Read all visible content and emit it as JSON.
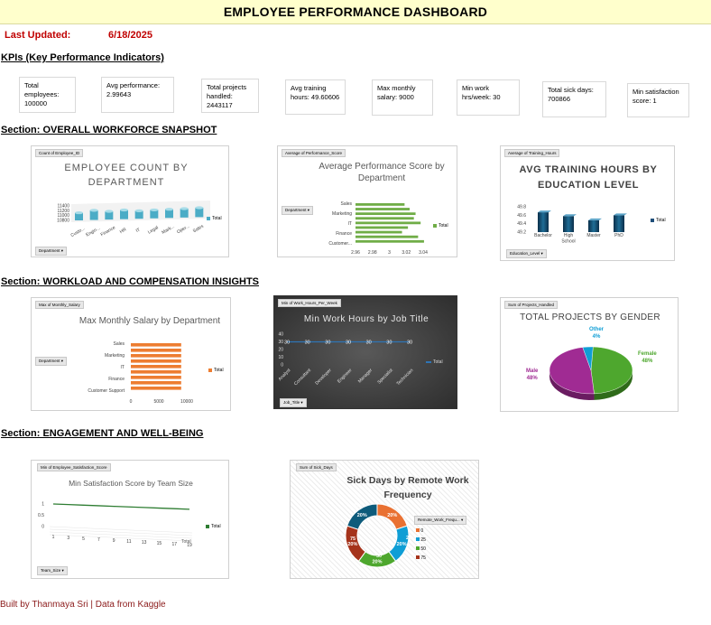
{
  "title": "EMPLOYEE PERFORMANCE DASHBOARD",
  "last_updated_label": "Last Updated:",
  "last_updated_value": "6/18/2025",
  "kpi_header": "KPIs (Key Performance Indicators)",
  "kpis": [
    {
      "text": "Total employees: 100000",
      "color": "#9dc3e6"
    },
    {
      "text": "Avg performance: 2.99643",
      "color": "#ed7d31"
    },
    {
      "text": "Total projects handled: 2443117",
      "color": "#92e28e"
    },
    {
      "text": "Avg training hours: 49.60606",
      "color": "#cccc00"
    },
    {
      "text": "Max monthly salary: 9000",
      "color": "#bfbfbf"
    },
    {
      "text": "Min work hrs/week: 30",
      "color": "#c48ef0"
    },
    {
      "text": "Total sick days: 700866",
      "color": "#f8cbcb"
    },
    {
      "text": "Min satisfaction score: 1",
      "color": "#ecc47e"
    }
  ],
  "sections": {
    "s1": "Section: OVERALL WORKFORCE SNAPSHOT",
    "s2": "Section: WORKLOAD AND COMPENSATION INSIGHTS",
    "s3": "Section: ENGAGEMENT AND WELL-BEING"
  },
  "charts": {
    "emp": {
      "field": "Count of Employee_ID",
      "title_l1": "EMPLOYEE COUNT BY",
      "title_l2": "DEPARTMENT",
      "filter": "Department",
      "legend": "Total",
      "ticks": [
        "11400",
        "11200",
        "11000",
        "10800"
      ],
      "categories": [
        "Custo...",
        "Engin...",
        "Finance",
        "HR",
        "IT",
        "Legal",
        "Mark...",
        "Oper...",
        "Sales"
      ],
      "values": [
        11116,
        11200,
        11140,
        11180,
        11131,
        11150,
        11160,
        11170,
        11190
      ],
      "ylim": [
        10800,
        11400
      ]
    },
    "perf": {
      "field": "Average of Performance_Score",
      "title_l1": "Average Performance Score by",
      "title_l2": "Department",
      "filter": "Department",
      "legend": "Total",
      "categories": [
        "Sales",
        "Marketing",
        "IT",
        "Finance",
        "Customer..."
      ],
      "values": [
        3.018,
        3.024,
        3.031,
        3.029,
        3.037,
        3.022,
        3.015,
        3.034,
        3.041
      ],
      "xticks": [
        "2.96",
        "2.98",
        "3",
        "3.02",
        "3.04"
      ],
      "xlim": [
        2.96,
        3.04
      ]
    },
    "train": {
      "field": "Average of Training_Hours",
      "title_l1": "AVG TRAINING HOURS BY",
      "title_l2": "EDUCATION LEVEL",
      "filter": "Education_Level",
      "legend": "Total",
      "ticks": [
        "49.8",
        "49.6",
        "49.4",
        "49.2"
      ],
      "categories": [
        "Bachelor",
        "High School",
        "Master",
        "PhD"
      ],
      "values": [
        49.67,
        49.58,
        49.48,
        49.6
      ],
      "ylim": [
        49.2,
        49.8
      ]
    },
    "salary": {
      "field": "Max of Monthly_Salary",
      "title": "Max Monthly Salary by Department",
      "filter": "Department",
      "legend": "Total",
      "categories": [
        "Sales",
        "Marketing",
        "IT",
        "Finance",
        "Customer Support"
      ],
      "values": [
        9000,
        9000,
        9000,
        9000,
        9000,
        9000,
        9000,
        9000,
        9000
      ],
      "xticks": [
        "0",
        "5000",
        "10000"
      ],
      "xlim": [
        0,
        10000
      ]
    },
    "hours": {
      "field": "Min of Work_Hours_Per_Week",
      "title": "Min Work Hours by Job Title",
      "filter": "Job_Title",
      "legend": "Total",
      "ticks": [
        "40",
        "30",
        "20",
        "10",
        "0"
      ],
      "categories": [
        "Analyst",
        "Consultant",
        "Developer",
        "Engineer",
        "Manager",
        "Specialist",
        "Technician"
      ],
      "values": [
        30,
        30,
        30,
        30,
        30,
        30,
        30
      ],
      "data_labels": [
        "30",
        "30",
        "30",
        "30",
        "30",
        "30",
        "30"
      ],
      "ylim": [
        0,
        40
      ]
    },
    "gender": {
      "field": "Sum of Projects_Handled",
      "title": "TOTAL PROJECTS BY GENDER",
      "slices": [
        {
          "name": "Female",
          "value": 48,
          "label": "48%",
          "color": "#4ea72e"
        },
        {
          "name": "Male",
          "value": 48,
          "label": "48%",
          "color": "#a02b93"
        },
        {
          "name": "Other",
          "value": 4,
          "label": "4%",
          "color": "#0f9ed5"
        }
      ]
    },
    "satisfaction": {
      "field": "Min of Employee_Satisfaction_Score",
      "title": "Min Satisfaction Score by Team Size",
      "filter": "Team_Size",
      "legend": "Total",
      "ticks": [
        "1",
        "0.5",
        "0"
      ],
      "categories": [
        "1",
        "3",
        "5",
        "7",
        "9",
        "11",
        "13",
        "15",
        "17",
        "19"
      ],
      "values": [
        1,
        1,
        1,
        1,
        1,
        1,
        1,
        1,
        1,
        1
      ],
      "ylim": [
        0,
        1
      ]
    },
    "sick": {
      "field": "Sum of Sick_Days",
      "title_l1": "Sick Days by Remote Work",
      "title_l2": "Frequency",
      "legend_title": "Remote_Work_Frequ...",
      "slices": [
        {
          "name": "0",
          "value": 20,
          "label": "20%",
          "color": "#e97132"
        },
        {
          "name": "25",
          "value": 20,
          "label": "20%",
          "color": "#0f9ed5"
        },
        {
          "name": "50",
          "value": 20,
          "label": "20%",
          "color": "#4ea72e"
        },
        {
          "name": "75",
          "value": 20,
          "label": "20%",
          "color": "#a5331b"
        },
        {
          "name": "100",
          "value": 20,
          "label": "20%",
          "color": "#0e5b7b"
        }
      ],
      "outer_labels": [
        "100",
        "25",
        "50",
        "75"
      ]
    }
  },
  "footer": "Built by Thanmaya Sri | Data from Kaggle"
}
